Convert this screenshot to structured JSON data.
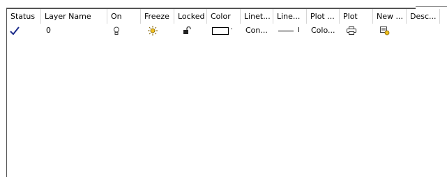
{
  "columns": [
    "Status",
    "Layer Name",
    "On",
    "Freeze",
    "Locked",
    "Color",
    "Linet...",
    "Line...",
    "Plot ...",
    "Plot",
    "New ...",
    "Desc..."
  ],
  "rows": [
    {
      "status_icon": "current-layer-checkmark-icon",
      "name": "0",
      "on_icon": "lightbulb-on-icon",
      "freeze_icon": "sun-thawed-icon",
      "locked_icon": "padlock-unlocked-icon",
      "color_swatch": "#ffffff",
      "color_name_fragment": "'",
      "linetype": "Con...",
      "lineweight_fragment": "I",
      "plot_style": "Colo...",
      "plot_icon": "printer-icon",
      "new_vp_freeze_icon": "new-viewport-freeze-icon"
    }
  ]
}
